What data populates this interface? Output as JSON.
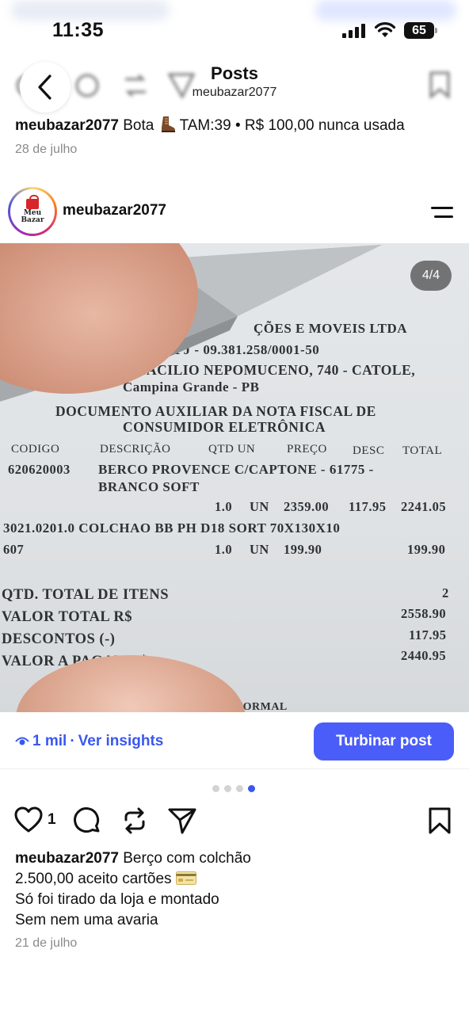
{
  "status_bar": {
    "time": "11:35",
    "battery": "65"
  },
  "nav": {
    "title": "Posts",
    "subtitle": "meubazar2077"
  },
  "previous_post": {
    "username": "meubazar2077",
    "caption_before_emoji": "Bota",
    "caption_emoji": "boot-emoji",
    "caption_after_emoji": "TAM:39 • R$ 100,00 nunca usada",
    "date": "28 de julho"
  },
  "post": {
    "username": "meubazar2077",
    "avatar_text_line1": "Meu",
    "avatar_text_line2": "Bazar",
    "slide_counter": "4/4",
    "receipt_lines": [
      "ÇÕES E MOVEIS LTDA",
      "NPJ - 09.381.258/0001-50",
      "OTACILIO NEPOMUCENO, 740 - CATOLE,",
      "Campina Grande - PB",
      "DOCUMENTO AUXILIAR DA NOTA FISCAL DE",
      "CONSUMIDOR ELETRÔNICA",
      "CODIGO",
      "DESCRIÇÃO",
      "QTD UN",
      "PREÇO",
      "DESC",
      "TOTAL",
      "620620003",
      "BERCO PROVENCE C/CAPTONE - 61775 -",
      "BRANCO SOFT",
      "1.0",
      "UN",
      "2359.00",
      "117.95",
      "2241.05",
      "3021.0201.0 COLCHAO BB PH D18 SORT 70X130X10",
      "607",
      "1.0",
      "UN",
      "199.90",
      "199.90",
      "QTD. TOTAL DE ITENS",
      "2",
      "VALOR TOTAL R$",
      "2558.90",
      "DESCONTOS (-)",
      "117.95",
      "VALOR A PAGAR R$",
      "2440.95",
      "NORMAL"
    ],
    "views": "1 mil",
    "insights_label": "Ver insights",
    "boost_label": "Turbinar post",
    "likes": "1",
    "caption_line1": "Berço com colchão",
    "caption_line2": "2.500,00 aceito cartões",
    "caption_line2_emoji": "credit-card-emoji",
    "caption_line3": "Só foi tirado da loja e montado",
    "caption_line4": "Sem nem uma avaria",
    "date": "21 de julho"
  },
  "colors": {
    "accent": "#3a57f0",
    "button": "#4a5df9",
    "muted_text": "#8a8a8a"
  }
}
